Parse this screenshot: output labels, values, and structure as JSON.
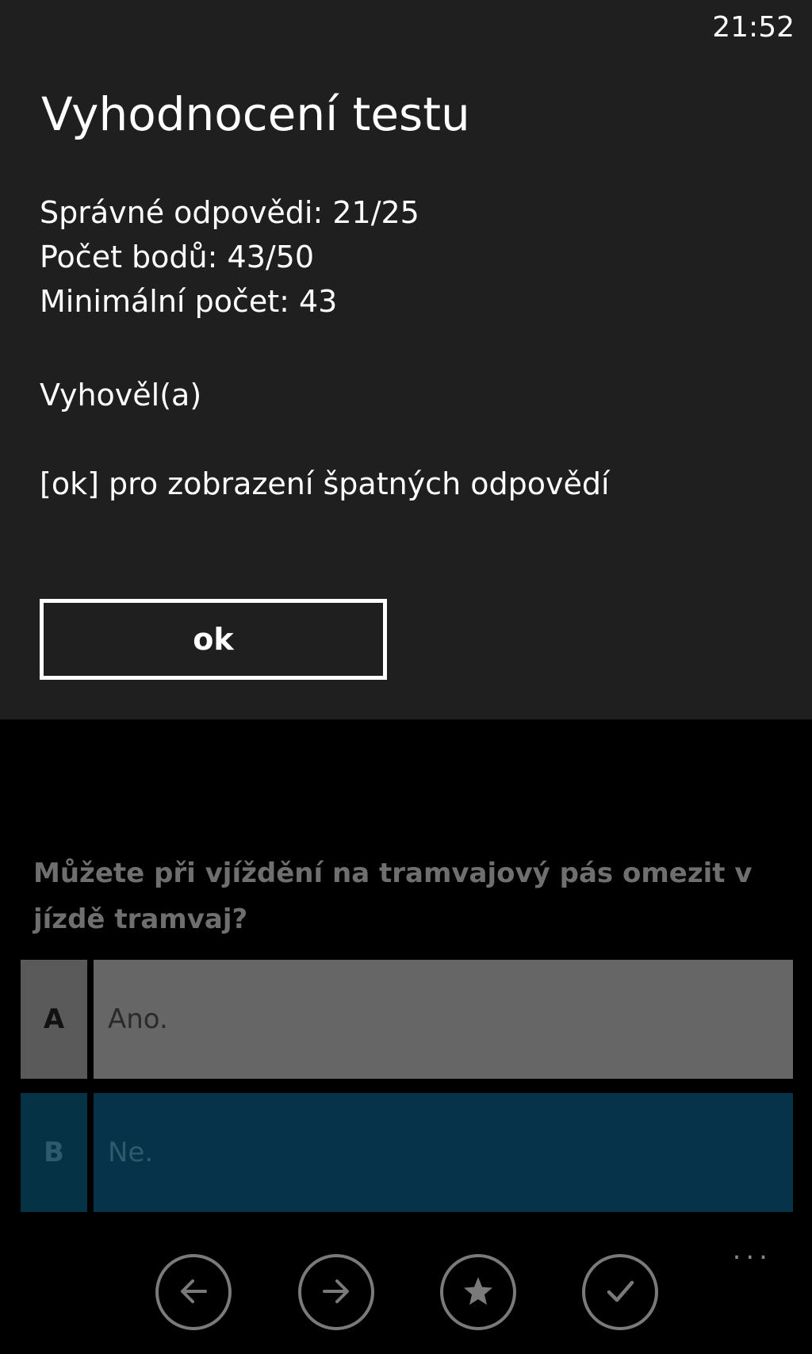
{
  "status_bar": {
    "time": "21:52"
  },
  "dialog": {
    "title": "Vyhodnocení testu",
    "stats": {
      "correct": "Správné odpovědi: 21/25",
      "points": "Počet bodů: 43/50",
      "minimum": "Minimální počet: 43"
    },
    "verdict": "Vyhověl(a)",
    "hint": "[ok] pro zobrazení špatných odpovědí",
    "ok_label": "ok"
  },
  "question": {
    "text": "Můžete při vjíždění na tramvajový pás omezit v jízdě tramvaj?",
    "answers": [
      {
        "letter": "A",
        "text": "Ano."
      },
      {
        "letter": "B",
        "text": "Ne."
      }
    ]
  },
  "appbar": {
    "more": "...",
    "icons": [
      "back-arrow-icon",
      "forward-arrow-icon",
      "star-icon",
      "check-icon"
    ]
  },
  "colors": {
    "dialog_bg": "#1f1f1f",
    "page_bg": "#000000",
    "answer_a_bg": "#666666",
    "answer_b_bg": "#06324a"
  }
}
